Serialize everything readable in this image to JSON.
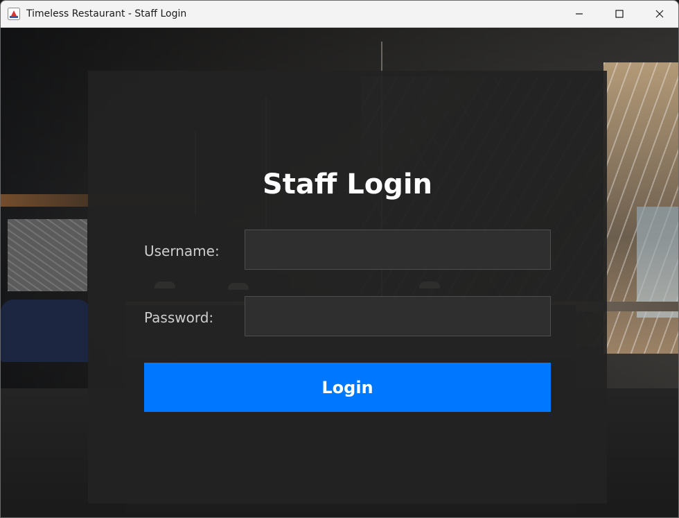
{
  "window": {
    "title": "Timeless Restaurant - Staff Login",
    "app_icon": "java-app-icon",
    "controls": [
      "minimize-icon",
      "maximize-icon",
      "close-icon"
    ]
  },
  "login": {
    "heading": "Staff Login",
    "username_label": "Username:",
    "username_value": "",
    "password_label": "Password:",
    "password_value": "",
    "button_label": "Login"
  },
  "colors": {
    "panel_background": "#222222",
    "input_background": "#2f2f2f",
    "button_accent": "#0077ff",
    "heading_text": "#ffffff",
    "label_text": "#cfcfcf"
  }
}
